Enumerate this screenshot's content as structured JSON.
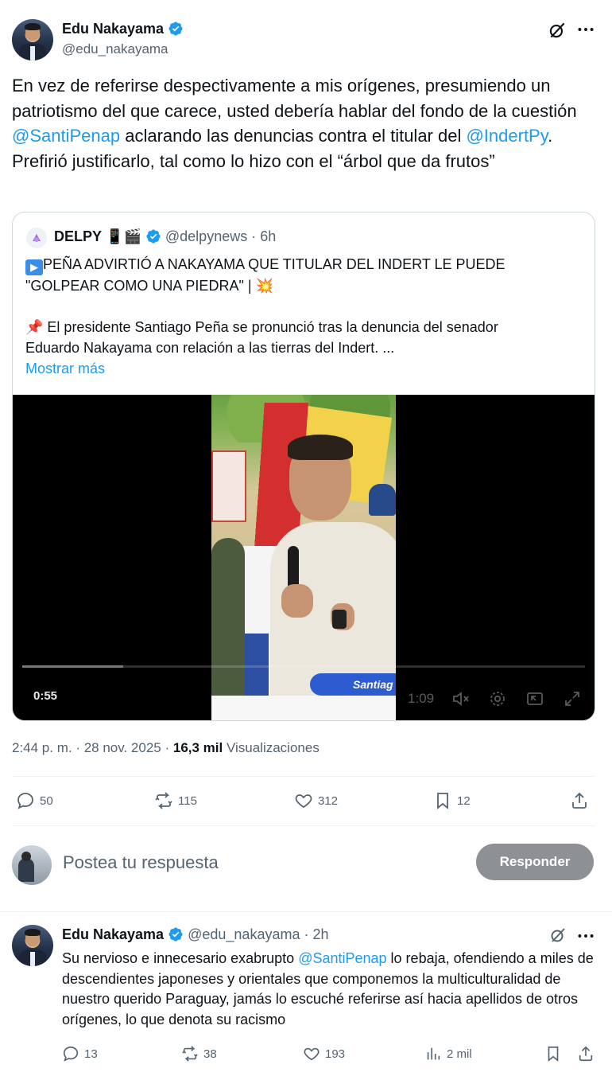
{
  "tweet": {
    "author_name": "Edu Nakayama",
    "author_handle": "@edu_nakayama",
    "text_parts": {
      "p1": "En vez de referirse despectivamente a mis orígenes, presumiendo un patriotismo del que carece, usted debería hablar del fondo de la cuestión ",
      "mention1": "@SantiPenap",
      "p2": " aclarando las denuncias contra el titular del ",
      "mention2": "@IndertPy",
      "p3": ". Prefirió justificarlo, tal como lo hizo con el “árbol que da frutos”"
    },
    "timestamp": "2:44 p. m. · 28 nov. 2025 · ",
    "views_count": "16,3 mil",
    "views_label": " Visualizaciones",
    "stats": {
      "replies": "50",
      "retweets": "115",
      "likes": "312",
      "bookmarks": "12"
    }
  },
  "quote": {
    "author_name": "DELPY",
    "name_emojis": "📱🎬",
    "author_handle": "@delpynews",
    "time": "· 6h",
    "line1_icon": "▶",
    "line1": "PEÑA ADVIRTIÓ A NAKAYAMA QUE TITULAR DEL INDERT LE PUEDE",
    "line2": "\"GOLPEAR COMO UNA PIEDRA\" | 💥",
    "line3_icon": "📌",
    "line3": " El presidente Santiago Peña se pronunció tras la denuncia del senador",
    "line4": "Eduardo Nakayama con relación a las tierras del Indert. ...",
    "show_more": "Mostrar más",
    "video": {
      "elapsed": "0:55",
      "duration": "1:09",
      "caption": "Santiag"
    }
  },
  "reply_box": {
    "placeholder": "Postea tu respuesta",
    "button_label": "Responder"
  },
  "reply": {
    "author_name": "Edu Nakayama",
    "author_handle": "@edu_nakayama",
    "time": "· 2h",
    "text_parts": {
      "p1": "Su nervioso e innecesario exabrupto ",
      "mention": "@SantiPenap",
      "p2": " lo rebaja, ofendiendo a miles de descendientes japoneses y orientales que componemos la multiculturalidad de nuestro querido Paraguay, jamás lo escuché referirse así hacia apellidos de otros orígenes, lo que denota su racismo"
    },
    "stats": {
      "replies": "13",
      "retweets": "38",
      "likes": "193",
      "views": "2 mil"
    }
  },
  "colors": {
    "link": "#1d9bf0",
    "verified": "#1d9bf0",
    "muted": "#536471",
    "border": "#cfd9de",
    "button": "#8d9195"
  }
}
